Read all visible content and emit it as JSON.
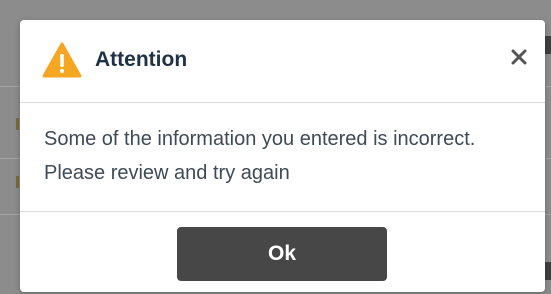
{
  "dialog": {
    "title": "Attention",
    "message": "Some of the information you entered is incorrect. Please review and try again",
    "ok_label": "Ok",
    "close_glyph": "×",
    "icon": "warning-triangle-icon",
    "colors": {
      "warning": "#f5a623",
      "title": "#1f3245",
      "button": "#474747",
      "overlay": "#8c8c8c"
    }
  }
}
